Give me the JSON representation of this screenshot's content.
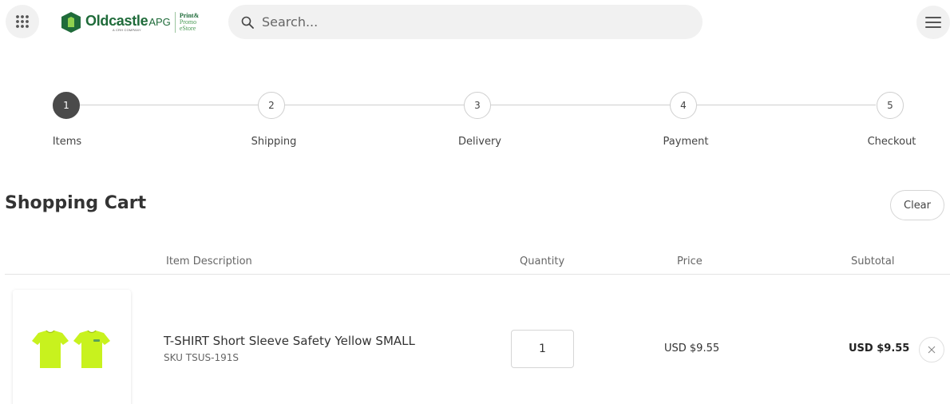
{
  "header": {
    "logo": {
      "brand": "Oldcastle",
      "brand_suffix": "APG",
      "brand_sub": "A CRH COMPANY",
      "tagline": [
        "Print&",
        "Promo",
        "eStore"
      ],
      "brand_color": "#1f6b3a"
    },
    "search": {
      "placeholder": "Search..."
    },
    "apps_icon": "grid-dots-icon",
    "menu_icon": "hamburger-menu-icon"
  },
  "stepper": {
    "active_step": 1,
    "steps": [
      {
        "number": "1",
        "label": "Items"
      },
      {
        "number": "2",
        "label": "Shipping"
      },
      {
        "number": "3",
        "label": "Delivery"
      },
      {
        "number": "4",
        "label": "Payment"
      },
      {
        "number": "5",
        "label": "Checkout"
      }
    ]
  },
  "cart": {
    "title": "Shopping Cart",
    "clear_label": "Clear",
    "columns": {
      "description": "Item Description",
      "quantity": "Quantity",
      "price": "Price",
      "subtotal": "Subtotal"
    },
    "items": [
      {
        "name": "T-SHIRT Short Sleeve Safety Yellow SMALL",
        "sku": "SKU TSUS-191S",
        "quantity": "1",
        "price": "USD $9.55",
        "subtotal": "USD $9.55",
        "image_icon": "safety-tshirt-image",
        "product_color": "#c8f21e"
      }
    ]
  }
}
